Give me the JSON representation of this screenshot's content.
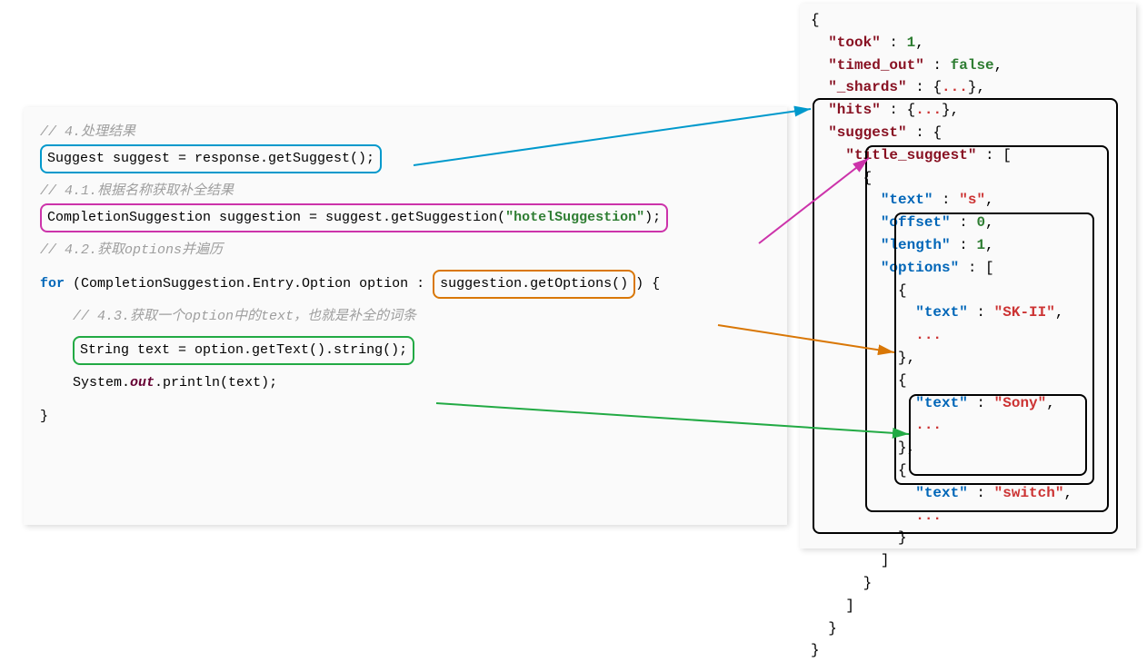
{
  "left": {
    "c1": "// 4.处理结果",
    "l1a": "Suggest suggest = response.getSuggest();",
    "c2": "// 4.1.根据名称获取补全结果",
    "l2a": "CompletionSuggestion suggestion = suggest.getSuggestion(",
    "l2str": "\"hotelSuggestion\"",
    "l2b": ");",
    "c3": "// 4.2.获取options并遍历",
    "l3a": "for",
    "l3b": " (CompletionSuggestion.Entry.Option option : ",
    "l3c": "suggestion.getOptions()",
    "l3d": ") {",
    "c4": "    // 4.3.获取一个option中的text，也就是补全的词条",
    "l4a": "String text = option.getText().string();",
    "l5a": "    System.",
    "l5b": "out",
    "l5c": ".println(text);",
    "l6": "}"
  },
  "right": {
    "r0": "{",
    "took_k": "\"took\"",
    "took_v": "1",
    "timed_k": "\"timed_out\"",
    "timed_v": "false",
    "shards_k": "\"_shards\"",
    "hits_k": "\"hits\"",
    "suggest_k": "\"suggest\"",
    "title_k": "\"title_suggest\"",
    "text_k": "\"text\"",
    "text_v": "\"s\"",
    "offset_k": "\"offset\"",
    "offset_v": "0",
    "length_k": "\"length\"",
    "length_v": "1",
    "options_k": "\"options\"",
    "opt1_k": "\"text\"",
    "opt1_v": "\"SK-II\"",
    "opt2_k": "\"text\"",
    "opt2_v": "\"Sony\"",
    "opt3_k": "\"text\"",
    "opt3_v": "\"switch\"",
    "ell": "...",
    "colon": " : ",
    "comma": ",",
    "lbrace": "{",
    "rbrace": "}",
    "lbrack": "[",
    "rbrack": "]",
    "rend": "}"
  },
  "colors": {
    "blue": "#0099cc",
    "magenta": "#cc33aa",
    "orange": "#d97706",
    "green": "#22aa44"
  }
}
